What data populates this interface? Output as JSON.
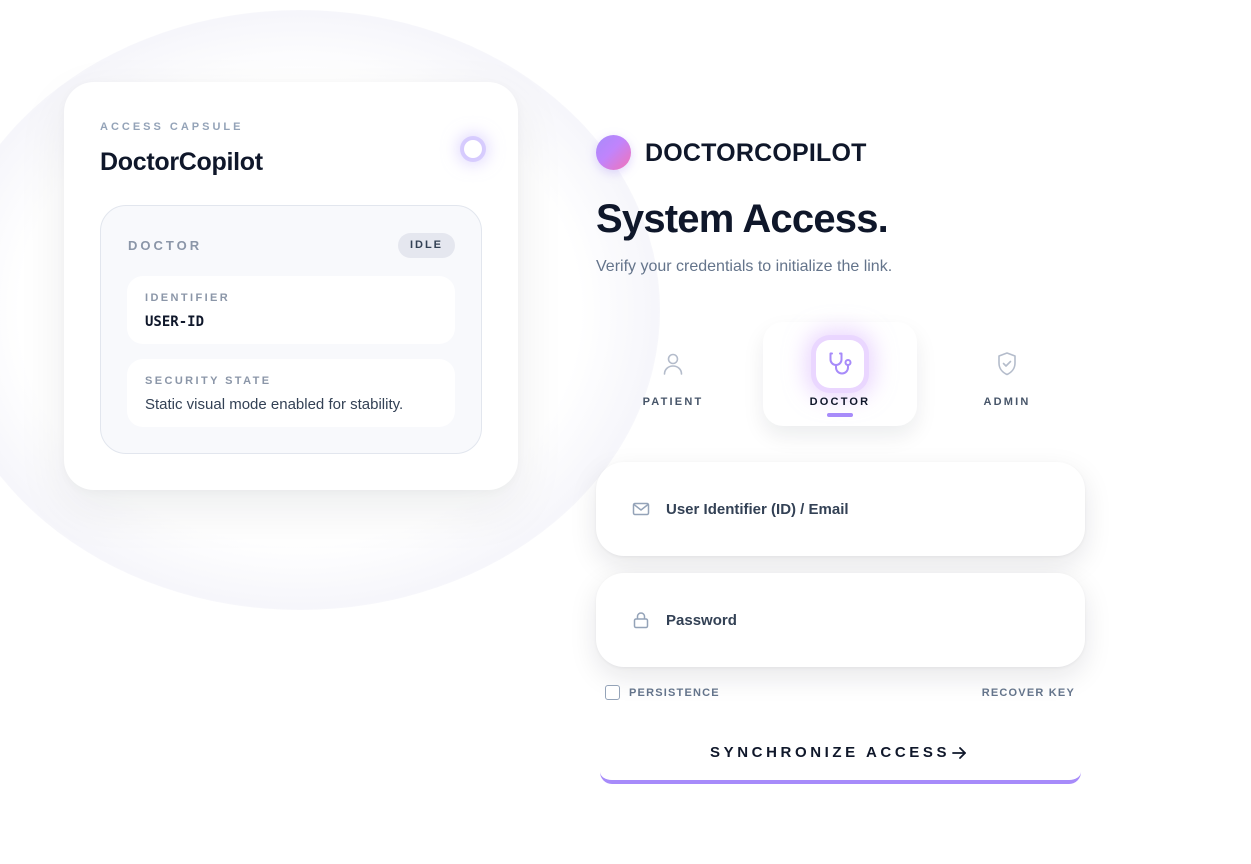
{
  "capsule": {
    "eyebrow": "ACCESS CAPSULE",
    "title": "DoctorCopilot",
    "role": "DOCTOR",
    "status_badge": "IDLE",
    "identifier_label": "IDENTIFIER",
    "identifier_value": "USER-ID",
    "security_label": "SECURITY STATE",
    "security_value": "Static visual mode enabled for stability."
  },
  "brand": {
    "name": "DOCTORCOPILOT"
  },
  "headline": "System Access.",
  "subline": "Verify your credentials to initialize the link.",
  "roles": [
    {
      "label": "PATIENT",
      "icon": "user-icon",
      "selected": false
    },
    {
      "label": "DOCTOR",
      "icon": "stethoscope-icon",
      "selected": true
    },
    {
      "label": "ADMIN",
      "icon": "shield-check-icon",
      "selected": false
    }
  ],
  "form": {
    "id_placeholder": "User Identifier (ID) / Email",
    "id_value": "",
    "password_placeholder": "Password",
    "password_value": "",
    "persistence_label": "PERSISTENCE",
    "recover_label": "RECOVER KEY",
    "submit_label": "SYNCHRONIZE ACCESS"
  },
  "colors": {
    "accent": "#a78bfa",
    "text_primary": "#0f172a",
    "text_muted": "#64748b"
  }
}
